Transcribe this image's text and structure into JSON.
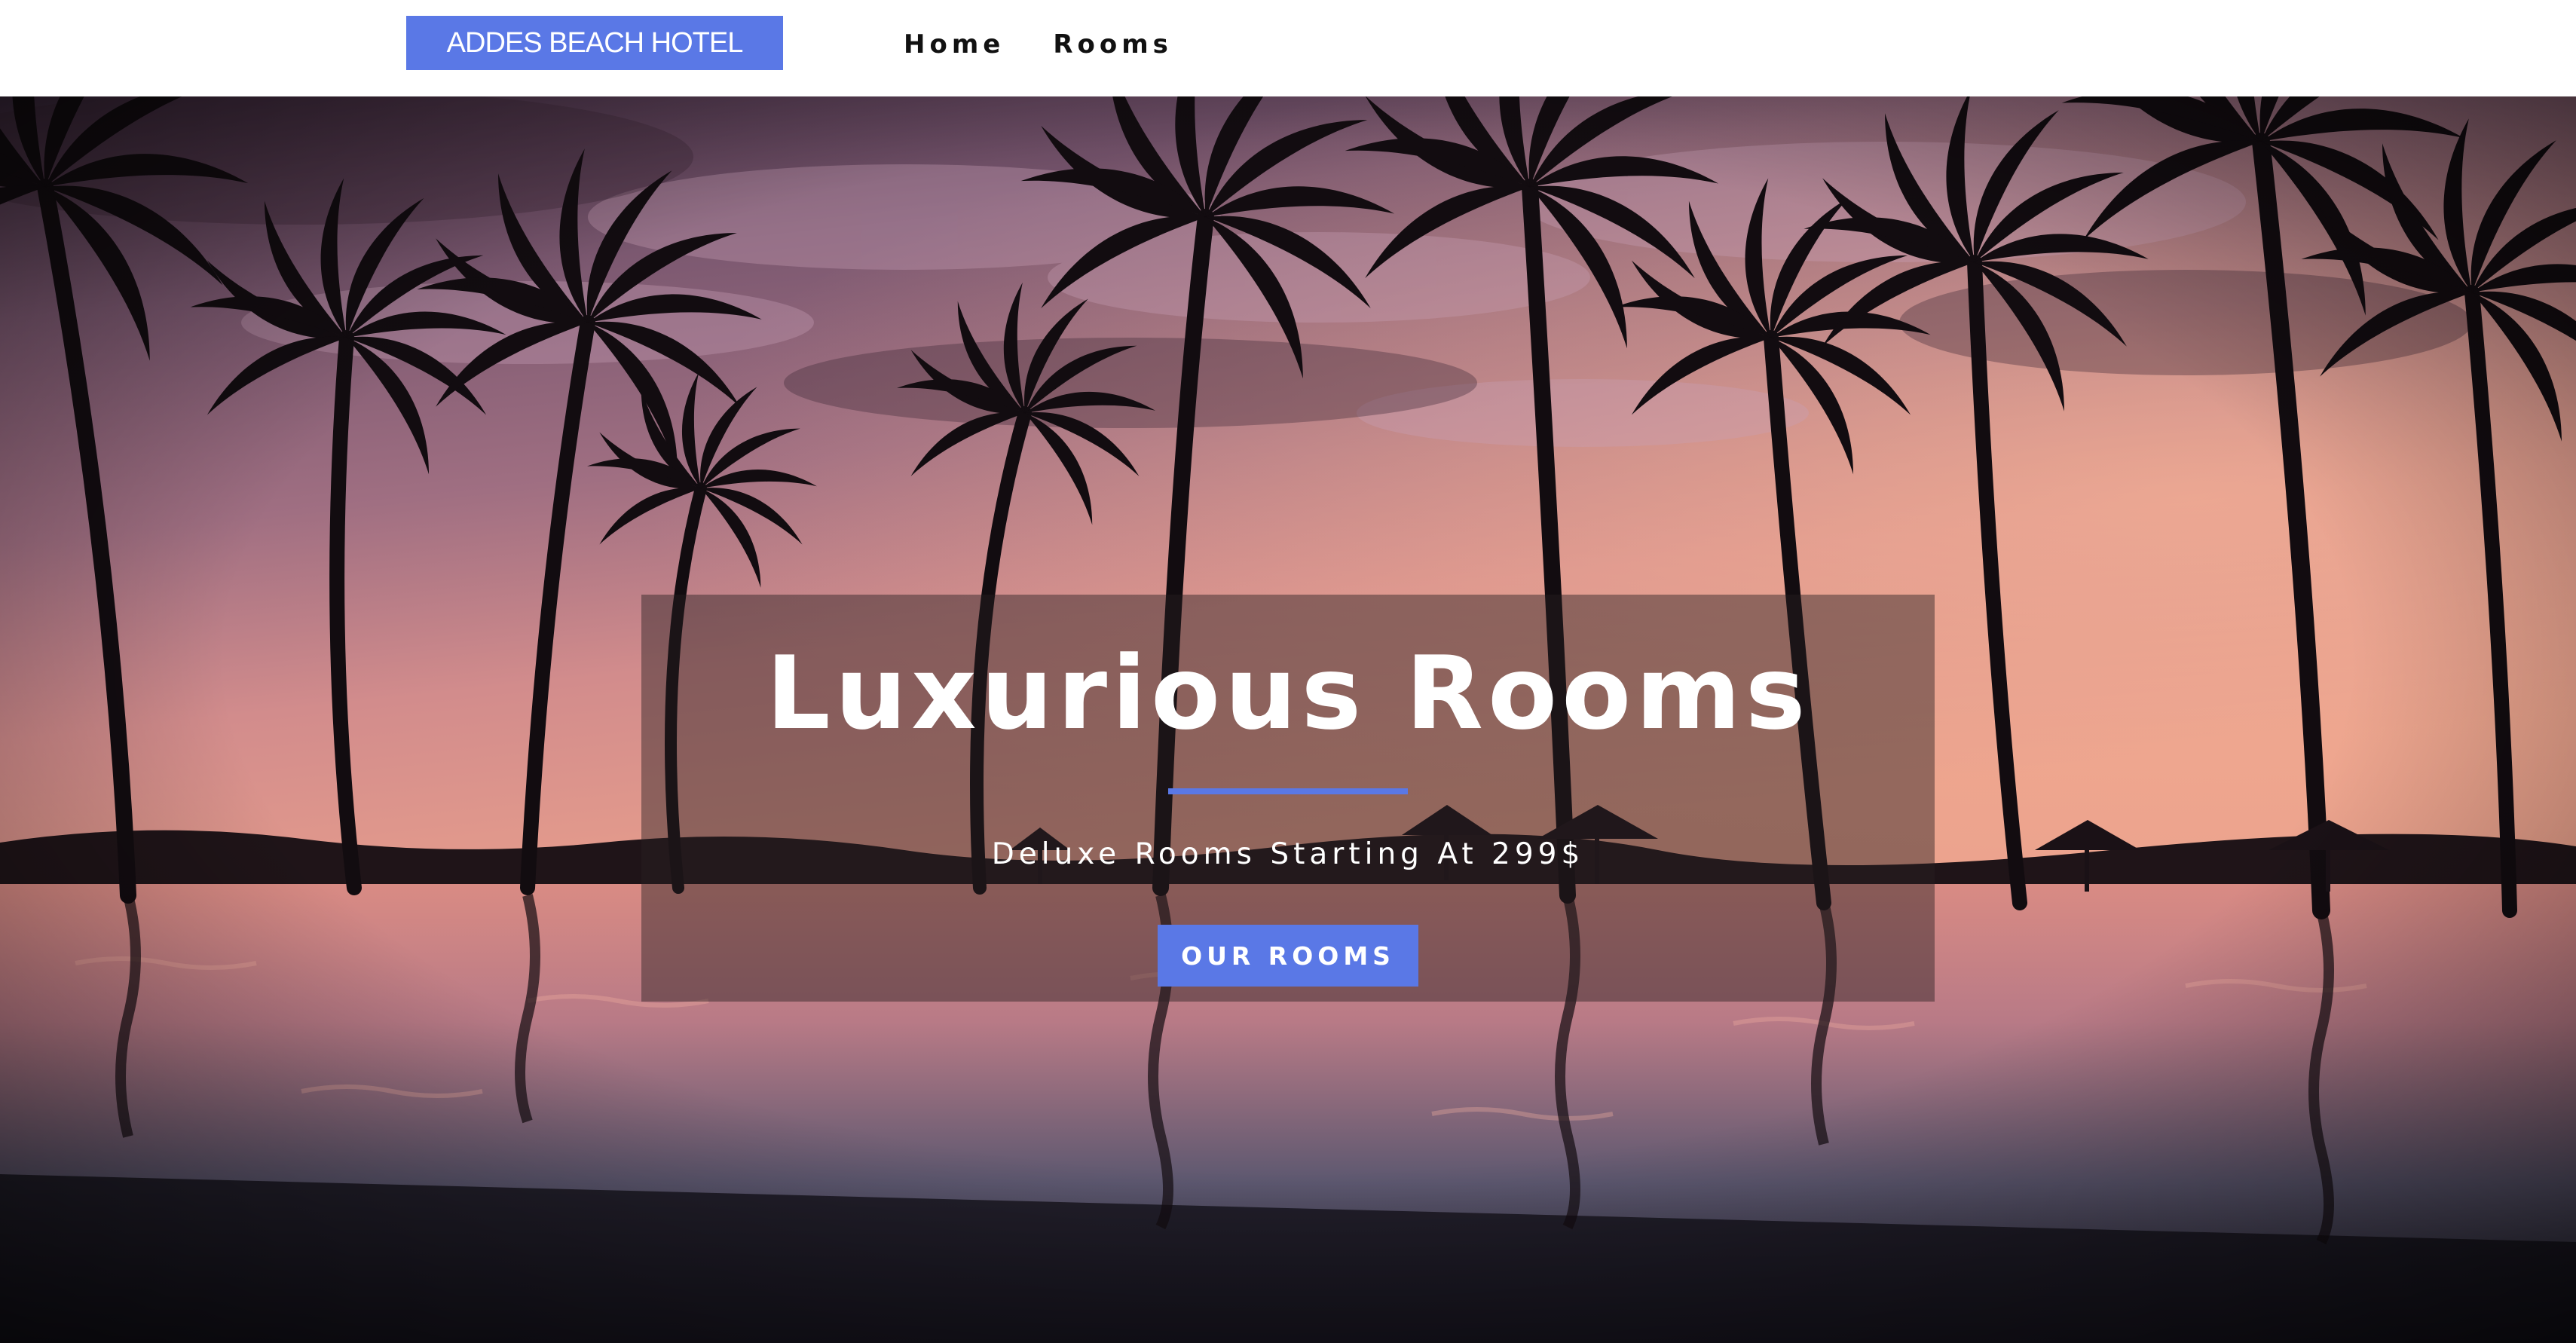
{
  "header": {
    "logo_text": "ADDES BEACH HOTEL",
    "nav_items": [
      "Home",
      "Rooms"
    ]
  },
  "hero": {
    "image_subject": "tropical resort pool with palm trees at sunset",
    "title": "Luxurious Rooms",
    "subtitle": "Deluxe Rooms Starting At 299$",
    "cta_label": "OUR ROOMS"
  },
  "colors": {
    "accent": "#5a78e6",
    "header_bg": "#ffffff",
    "nav_text": "#111111",
    "banner_text": "#ffffff"
  }
}
